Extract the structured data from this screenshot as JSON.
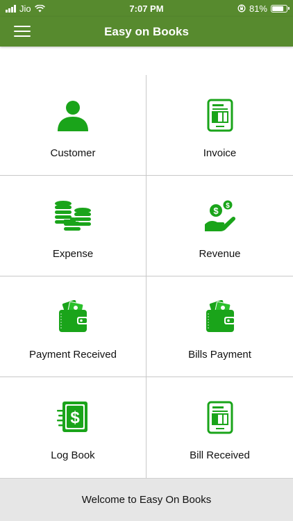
{
  "status_bar": {
    "carrier": "Jio",
    "time": "7:07 PM",
    "battery_text": "81%",
    "battery_level": 0.81,
    "icons": [
      "signal-icon",
      "wifi-icon",
      "orientation-lock-icon",
      "battery-icon"
    ]
  },
  "app_bar": {
    "title": "Easy on Books",
    "menu_icon": "hamburger-menu-icon",
    "color": "#578a2e"
  },
  "accent_color": "#1aa41a",
  "tiles": [
    {
      "label": "Customer",
      "icon": "person-icon"
    },
    {
      "label": "Invoice",
      "icon": "invoice-icon"
    },
    {
      "label": "Expense",
      "icon": "coins-stack-icon"
    },
    {
      "label": "Revenue",
      "icon": "hand-money-icon"
    },
    {
      "label": "Payment Received",
      "icon": "wallet-icon"
    },
    {
      "label": "Bills Payment",
      "icon": "wallet-icon"
    },
    {
      "label": "Log Book",
      "icon": "dollar-book-icon"
    },
    {
      "label": "Bill Received",
      "icon": "invoice-icon"
    }
  ],
  "footer": {
    "text": "Welcome to Easy On Books"
  }
}
